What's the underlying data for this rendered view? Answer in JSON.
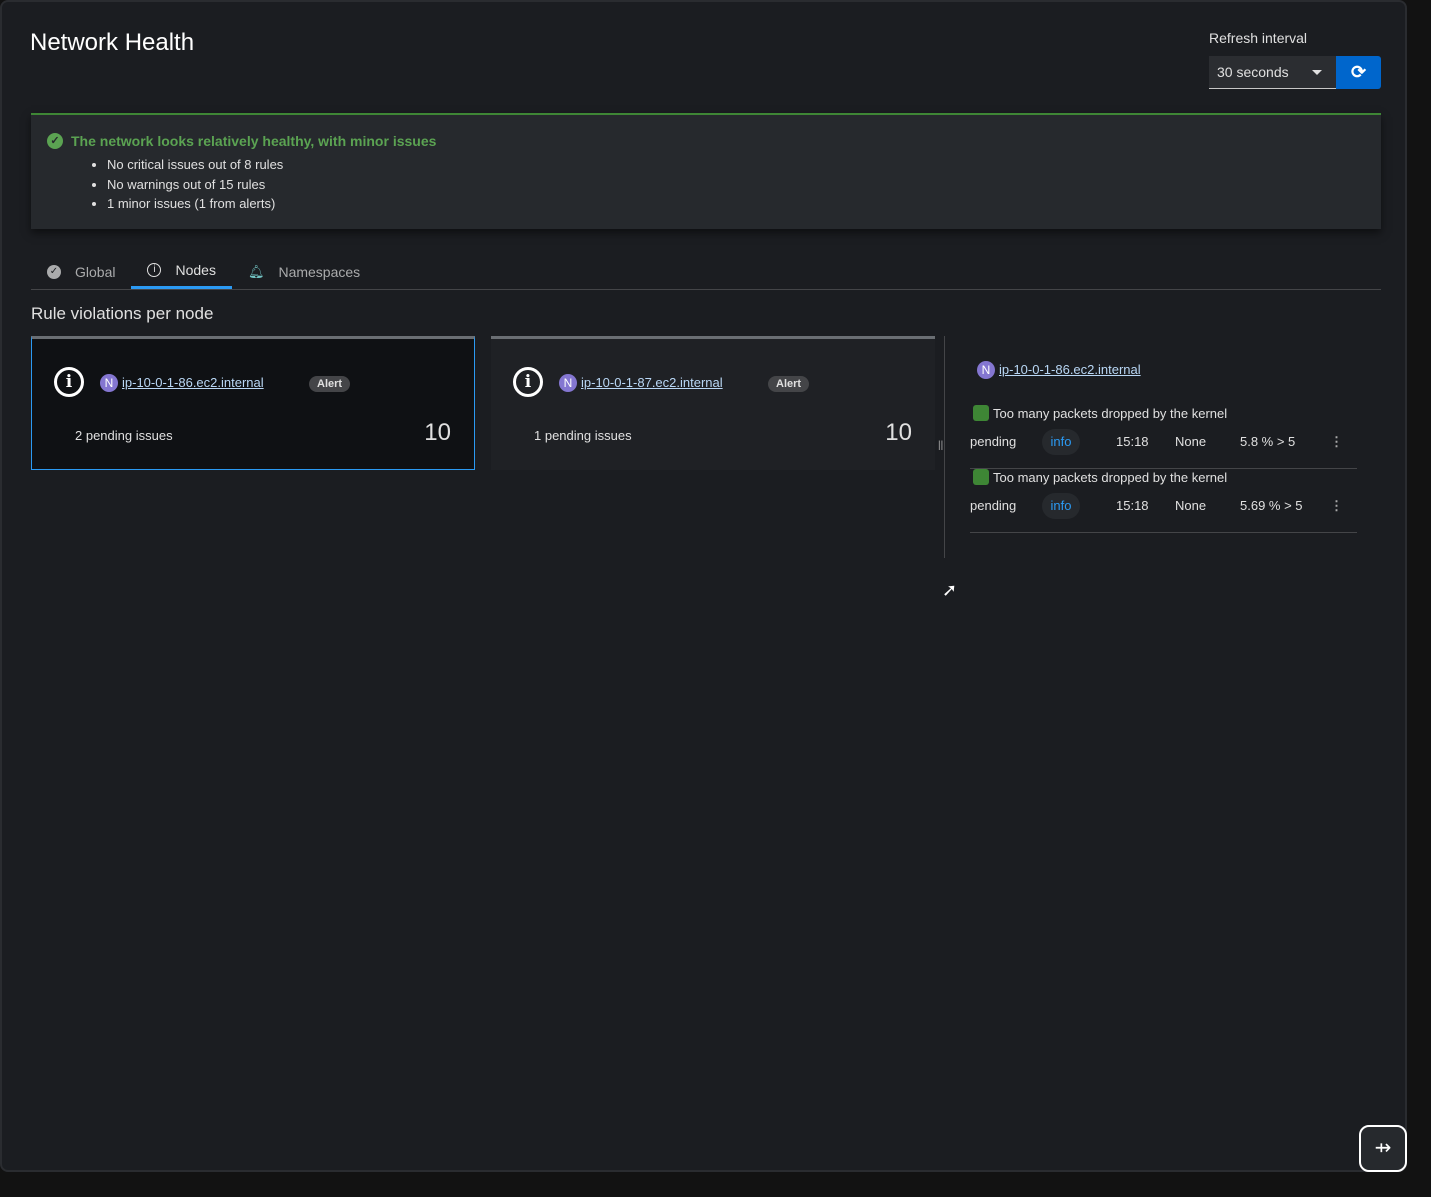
{
  "title": "Network Health",
  "refresh": {
    "label": "Refresh interval",
    "value": "30 seconds"
  },
  "alert": {
    "title": "The network looks relatively healthy, with minor issues",
    "items": [
      "No critical issues out of 8 rules",
      "No warnings out of 15 rules",
      "1 minor issues (1 from alerts)"
    ]
  },
  "tabs": [
    {
      "label": "Global"
    },
    {
      "label": "Nodes"
    },
    {
      "label": "Namespaces"
    }
  ],
  "section": "Rule violations per node",
  "cards": [
    {
      "badge": "N",
      "node": "ip-10-0-1-86.ec2.internal",
      "tag": "Alert",
      "pending": "2 pending issues",
      "score": "10"
    },
    {
      "badge": "N",
      "node": "ip-10-0-1-87.ec2.internal",
      "tag": "Alert",
      "pending": "1 pending issues",
      "score": "10"
    }
  ],
  "details": {
    "badge": "N",
    "node": "ip-10-0-1-86.ec2.internal",
    "rules": [
      {
        "name": "Too many packets dropped by the kernel",
        "state": "pending",
        "severity": "info",
        "time": "15:18",
        "silence": "None",
        "value": "5.8 % > 5"
      },
      {
        "name": "Too many packets dropped by the kernel",
        "state": "pending",
        "severity": "info",
        "time": "15:18",
        "silence": "None",
        "value": "5.69 % > 5"
      }
    ]
  }
}
